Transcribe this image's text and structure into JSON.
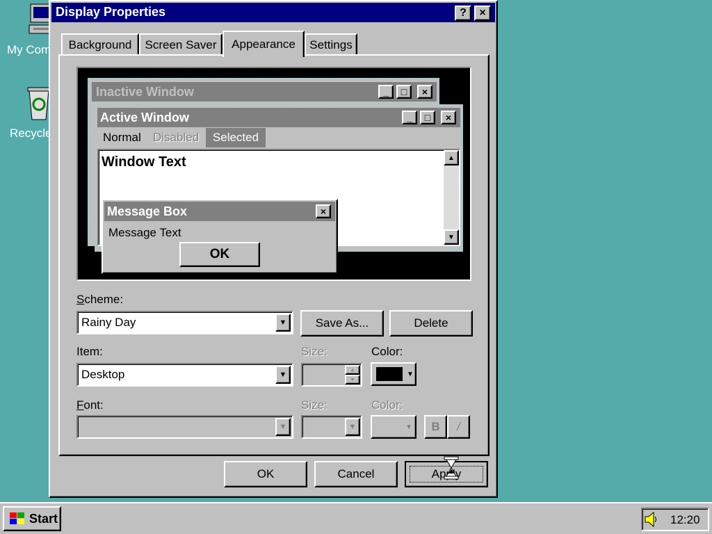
{
  "desktop": {
    "icons": [
      {
        "label": "My Computer",
        "icon": "computer-icon"
      },
      {
        "label": "Recycle Bin",
        "icon": "recycle-bin-icon"
      }
    ],
    "background_color": "#55AAAA"
  },
  "dialog": {
    "title": "Display Properties",
    "help_btn": "?",
    "close_btn": "×",
    "tabs": [
      {
        "label": "Background"
      },
      {
        "label": "Screen Saver"
      },
      {
        "label": "Appearance",
        "active": true
      },
      {
        "label": "Settings"
      }
    ],
    "preview": {
      "inactive_title": "Inactive Window",
      "active_title": "Active Window",
      "menu": [
        "Normal",
        "Disabled",
        "Selected"
      ],
      "window_text": "Window Text",
      "msgbox_title": "Message Box",
      "msgbox_text": "Message Text",
      "msgbox_ok": "OK"
    },
    "scheme": {
      "label": "Scheme:",
      "value": "Rainy Day",
      "save_as": "Save As...",
      "delete": "Delete"
    },
    "item": {
      "label": "Item:",
      "value": "Desktop",
      "size_label": "Size:",
      "color_label": "Color:",
      "color_value": "#000000"
    },
    "font": {
      "label": "Font:",
      "size_label": "Size:",
      "color_label": "Color:",
      "bold": "B",
      "italic": "/"
    },
    "buttons": {
      "ok": "OK",
      "cancel": "Cancel",
      "apply": "Apply"
    }
  },
  "taskbar": {
    "start": "Start",
    "clock": "12:20"
  },
  "colors": {
    "title_active": "#000080",
    "preview_inactive_title": "#808080",
    "preview_active_title": "#808080",
    "face": "#c0c0c0"
  }
}
